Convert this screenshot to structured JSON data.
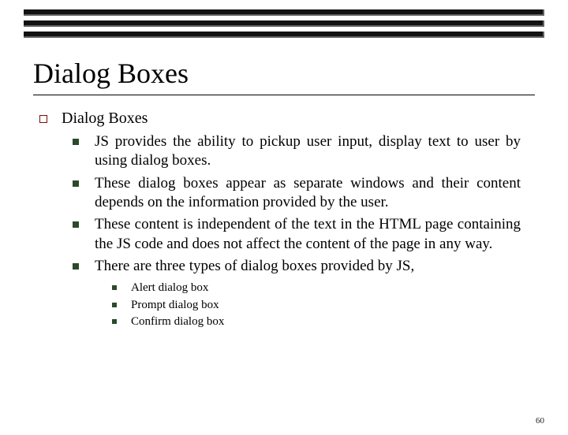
{
  "title": "Dialog Boxes",
  "outline": {
    "l1": "Dialog Boxes",
    "l2": [
      "JS provides the ability to pickup user input, display text to user by using dialog boxes.",
      "These dialog boxes appear as separate windows and their content depends on the information provided by the user.",
      "These content is independent of the text in the HTML page containing the JS code and does not affect the content of the page in any way.",
      "There are three types of dialog boxes provided by JS,"
    ],
    "l3": [
      "Alert dialog box",
      "Prompt dialog box",
      "Confirm dialog box"
    ]
  },
  "page_number": "60"
}
